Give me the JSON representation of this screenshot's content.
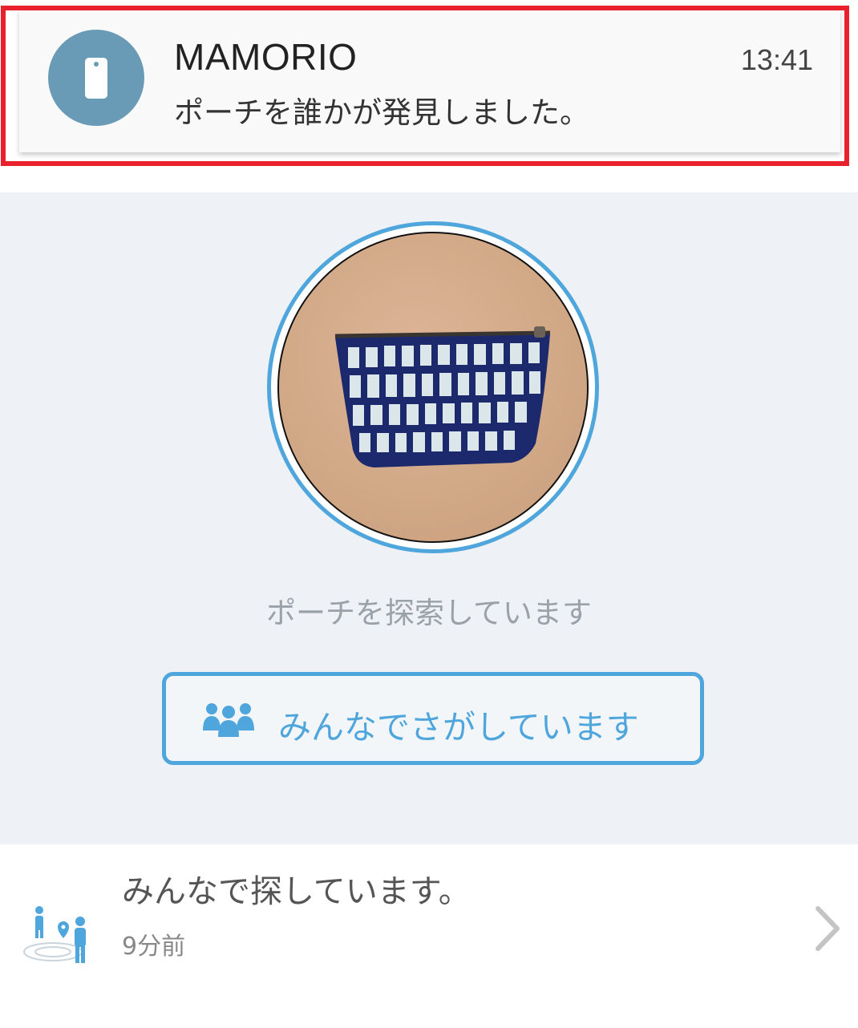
{
  "notification": {
    "app_name": "MAMORIO",
    "time": "13:41",
    "message": "ポーチを誰かが発見しました。",
    "icon": "tag-icon",
    "avatar_color": "#6a9bb6",
    "highlight_color": "#e8212d"
  },
  "item": {
    "photo": "pouch-photo",
    "status": "ポーチを探索しています"
  },
  "search_button": {
    "label": "みんなでさがしています",
    "icon": "people-group-icon",
    "accent_color": "#4ea6dc"
  },
  "activity": {
    "title": "みんなで探しています。",
    "time_ago": "9分前",
    "icon": "people-search-icon",
    "chevron": "chevron-right-icon"
  }
}
